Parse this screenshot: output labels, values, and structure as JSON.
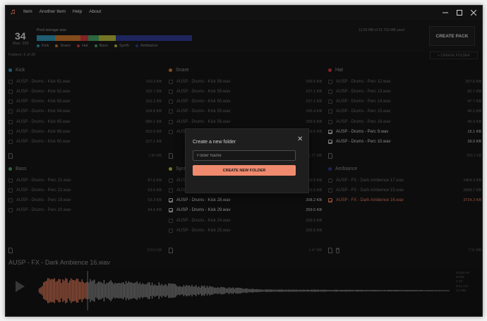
{
  "menu": [
    "Item",
    "Another Item",
    "Help",
    "About"
  ],
  "header": {
    "sample_count": "34",
    "sample_max": "Max: 255",
    "storage_label": "Pool storage size",
    "storage_used": "12.83 MB of 31.752 MB used",
    "storage_segments": [
      {
        "name": "Kick",
        "color": "#2e8fb0",
        "fraction": 0.12
      },
      {
        "name": "Snare",
        "color": "#c8742c",
        "fraction": 0.16
      },
      {
        "name": "Hat",
        "color": "#c8363d",
        "fraction": 0.05
      },
      {
        "name": "Bass",
        "color": "#43a062",
        "fraction": 0.07
      },
      {
        "name": "Synth",
        "color": "#b4b53a",
        "fraction": 0.11
      },
      {
        "name": "Ambiance",
        "color": "#2e3a8f",
        "fraction": 0.49
      }
    ],
    "create_pack_label": "CREATE PACK"
  },
  "folders_label": "Folders: 6 of 20",
  "create_folder_top_label": "+ CREATE FOLDER",
  "panels": [
    {
      "name": "Kick",
      "color": "#2e8fb0",
      "total": "1.80 MB",
      "rows": [
        {
          "name": "AUSP - Drums - Kick 61.wav",
          "size": "110.3 KB",
          "state": "unchecked"
        },
        {
          "name": "AUSP - Drums - Kick 62.wav",
          "size": "102.7 KB",
          "state": "unchecked"
        },
        {
          "name": "AUSP - Drums - Kick 63.wav",
          "size": "102.2 KB",
          "state": "unchecked"
        },
        {
          "name": "AUSP - Drums - Kick 64.wav",
          "size": "154.8 KB",
          "state": "unchecked"
        },
        {
          "name": "AUSP - Drums - Kick 65.wav",
          "size": "580.1 KB",
          "state": "unchecked"
        },
        {
          "name": "AUSP - Drums - Kick 66.wav",
          "size": "552.9 KB",
          "state": "unchecked"
        },
        {
          "name": "AUSP - Drums - Kick 60.wav",
          "size": "227.1 KB",
          "state": "unchecked"
        }
      ]
    },
    {
      "name": "Snare",
      "color": "#c8742c",
      "total": "1.27 MB",
      "rows": [
        {
          "name": "AUSP - Drums - Kick 58.wav",
          "size": "259.5 KB",
          "state": "unchecked"
        },
        {
          "name": "AUSP - Drums - Kick 59.wav",
          "size": "227.1 KB",
          "state": "unchecked"
        },
        {
          "name": "AUSP - Drums - Kick 60.wav",
          "size": "227.1 KB",
          "state": "unchecked"
        },
        {
          "name": "AUSP - Drums - Kick 55.wav",
          "size": "105.4 KB",
          "state": "unchecked"
        },
        {
          "name": "AUSP - Drums - Kick 56.wav",
          "size": "259.5 KB",
          "state": "unchecked"
        },
        {
          "name": "AUSP - Drums - Kick 57.wav",
          "size": "259.5 KB",
          "state": "unchecked"
        }
      ]
    },
    {
      "name": "Hat",
      "color": "#c8363d",
      "total": "555.1 KB",
      "rows": [
        {
          "name": "AUSP - Drums - Perc 12.wav",
          "size": "207.6 KB",
          "state": "unchecked"
        },
        {
          "name": "AUSP - Drums - Perc 13.wav",
          "size": "82.7 KB",
          "state": "unchecked"
        },
        {
          "name": "AUSP - Drums - Perc 14.wav",
          "size": "47.7 KB",
          "state": "unchecked"
        },
        {
          "name": "AUSP - Drums - Perc 15.wav",
          "size": "46.2 KB",
          "state": "unchecked"
        },
        {
          "name": "AUSP - Drums - Perc 16.wav",
          "size": "45.9 KB",
          "state": "unchecked"
        },
        {
          "name": "AUSP - Drums - Perc 9.wav",
          "size": "15.1 KB",
          "state": "checked"
        },
        {
          "name": "AUSP - Drums - Perc 10.wav",
          "size": "39.0 KB",
          "state": "checked"
        }
      ]
    },
    {
      "name": "Bass",
      "color": "#43a062",
      "total": "219.5 KB",
      "rows": [
        {
          "name": "AUSP - Drums - Perc 21.wav",
          "size": "87.6 KB",
          "state": "unchecked"
        },
        {
          "name": "AUSP - Drums - Perc 22.wav",
          "size": "63.6 KB",
          "state": "unchecked"
        },
        {
          "name": "AUSP - Drums - Perc 19.wav",
          "size": "53.3 KB",
          "state": "unchecked"
        },
        {
          "name": "AUSP - Drums - Perc 20.wav",
          "size": "54.6 KB",
          "state": "unchecked"
        }
      ]
    },
    {
      "name": "Synth",
      "color": "#b4b53a",
      "total": "1.47 MB",
      "rows": [
        {
          "name": "AUSP - Drums - Kick 26.wav",
          "size": "259.5 KB",
          "state": "unchecked"
        },
        {
          "name": "AUSP - Drums - Kick 27.wav",
          "size": "259.5 KB",
          "state": "unchecked"
        },
        {
          "name": "AUSP - Drums - Kick 28.wav",
          "size": "208.2 KB",
          "state": "checked"
        },
        {
          "name": "AUSP - Drums - Kick 29.wav",
          "size": "259.5 KB",
          "state": "checked"
        },
        {
          "name": "AUSP - Drums - Kick 24.wav",
          "size": "259.5 KB",
          "state": "unchecked"
        },
        {
          "name": "AUSP - Drums - Kick 25.wav",
          "size": "259.5 KB",
          "state": "unchecked"
        }
      ]
    },
    {
      "name": "Ambiance",
      "color": "#2e3a8f",
      "total": "7.51 MB",
      "rows": [
        {
          "name": "AUSP - FX - Dark Ambience 17.wav",
          "size": "1404.3 KB",
          "state": "unchecked"
        },
        {
          "name": "AUSP - FX - Dark Ambience 15.wav",
          "size": "2068.7 KB",
          "state": "unchecked"
        },
        {
          "name": "AUSP - FX - Dark Ambience 16.wav",
          "size": "3724.3 KB",
          "state": "selected"
        }
      ]
    }
  ],
  "player": {
    "title": "AUSP - FX - Dark Ambience 16.wav",
    "progress": 0.12,
    "info": [
      "44100 Hz",
      "24 Bit",
      "2 Ch",
      "0:21.174",
      "3.6 MB"
    ]
  },
  "dialog": {
    "title": "Create a new folder",
    "input_placeholder": "Folder Name",
    "input_value": "",
    "button_label": "CREATE NEW FOLDER",
    "accent": "#f08a6e"
  }
}
